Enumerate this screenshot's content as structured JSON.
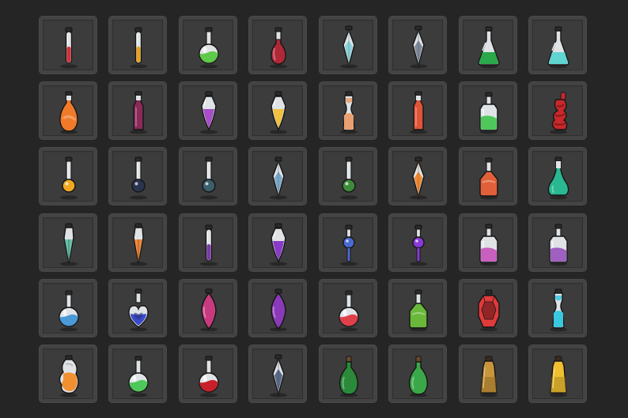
{
  "inventory": {
    "slots": [
      {
        "item": "slim-vial",
        "liquid": "#d3303a"
      },
      {
        "item": "slim-vial",
        "liquid": "#e8a020"
      },
      {
        "item": "round-flask",
        "liquid": "#5ec94a"
      },
      {
        "item": "narrow-flask",
        "liquid": "#b02838"
      },
      {
        "item": "crystal-vial",
        "liquid": "#8ad0d8"
      },
      {
        "item": "crystal-vial",
        "liquid": "#7f8a98"
      },
      {
        "item": "cone-flask",
        "liquid": "#2aa84a"
      },
      {
        "item": "cone-flask",
        "liquid": "#5fd4d0"
      },
      {
        "item": "teardrop-bottle",
        "liquid": "#f07a2a"
      },
      {
        "item": "tall-bottle",
        "liquid": "#8a2a58"
      },
      {
        "item": "shield-vial",
        "liquid": "#a84ec8"
      },
      {
        "item": "shield-vial",
        "liquid": "#f0c040"
      },
      {
        "item": "hourglass-vial",
        "liquid": "#e8a070"
      },
      {
        "item": "tall-bottle",
        "liquid": "#e0543a"
      },
      {
        "item": "square-bottle",
        "liquid": "#4ec85a"
      },
      {
        "item": "twisted-bottle",
        "liquid": "#c8282a"
      },
      {
        "item": "bulb-vial",
        "liquid": "#f0a820"
      },
      {
        "item": "bulb-vial",
        "liquid": "#2a3450"
      },
      {
        "item": "bulb-vial",
        "liquid": "#3a5e6a"
      },
      {
        "item": "crystal-vial",
        "liquid": "#7aa8c8"
      },
      {
        "item": "bulb-vial",
        "liquid": "#3e8a3a"
      },
      {
        "item": "crystal-vial",
        "liquid": "#f08a30"
      },
      {
        "item": "wide-flask",
        "liquid": "#e0603a"
      },
      {
        "item": "bell-flask",
        "liquid": "#2ab890"
      },
      {
        "item": "shard-vial",
        "liquid": "#6ac0a8"
      },
      {
        "item": "shard-vial",
        "liquid": "#f08a40"
      },
      {
        "item": "slim-vial",
        "liquid": "#7a3aa8"
      },
      {
        "item": "shield-vial",
        "liquid": "#8a3ac8"
      },
      {
        "item": "orb-wand",
        "liquid": "#4a6ad0"
      },
      {
        "item": "orb-wand",
        "liquid": "#8a3ad8"
      },
      {
        "item": "square-bottle",
        "liquid": "#c860c0"
      },
      {
        "item": "square-bottle",
        "liquid": "#a060c0"
      },
      {
        "item": "round-flask",
        "liquid": "#4a9ad8"
      },
      {
        "item": "heart-flask",
        "liquid": "#3a4ac8"
      },
      {
        "item": "drop-gem",
        "liquid": "#c83a80"
      },
      {
        "item": "drop-gem",
        "liquid": "#8a3ab8"
      },
      {
        "item": "round-flask",
        "liquid": "#e0404a"
      },
      {
        "item": "wide-flask",
        "liquid": "#6ab83a"
      },
      {
        "item": "gem-flask",
        "liquid": "#e03a3a"
      },
      {
        "item": "hourglass-vial",
        "liquid": "#3ac8e0"
      },
      {
        "item": "swirl-bottle",
        "liquid": "#f09030"
      },
      {
        "item": "round-flask",
        "liquid": "#4ec85a"
      },
      {
        "item": "round-flask",
        "liquid": "#c8202a"
      },
      {
        "item": "crystal-vial",
        "liquid": "#5a6a88"
      },
      {
        "item": "gourd-bottle",
        "liquid": "#2a8a3a"
      },
      {
        "item": "gourd-bottle",
        "liquid": "#3aa848"
      },
      {
        "item": "jar-bottle",
        "liquid": "#c8963a"
      },
      {
        "item": "jar-bottle",
        "liquid": "#f0c030"
      }
    ]
  }
}
